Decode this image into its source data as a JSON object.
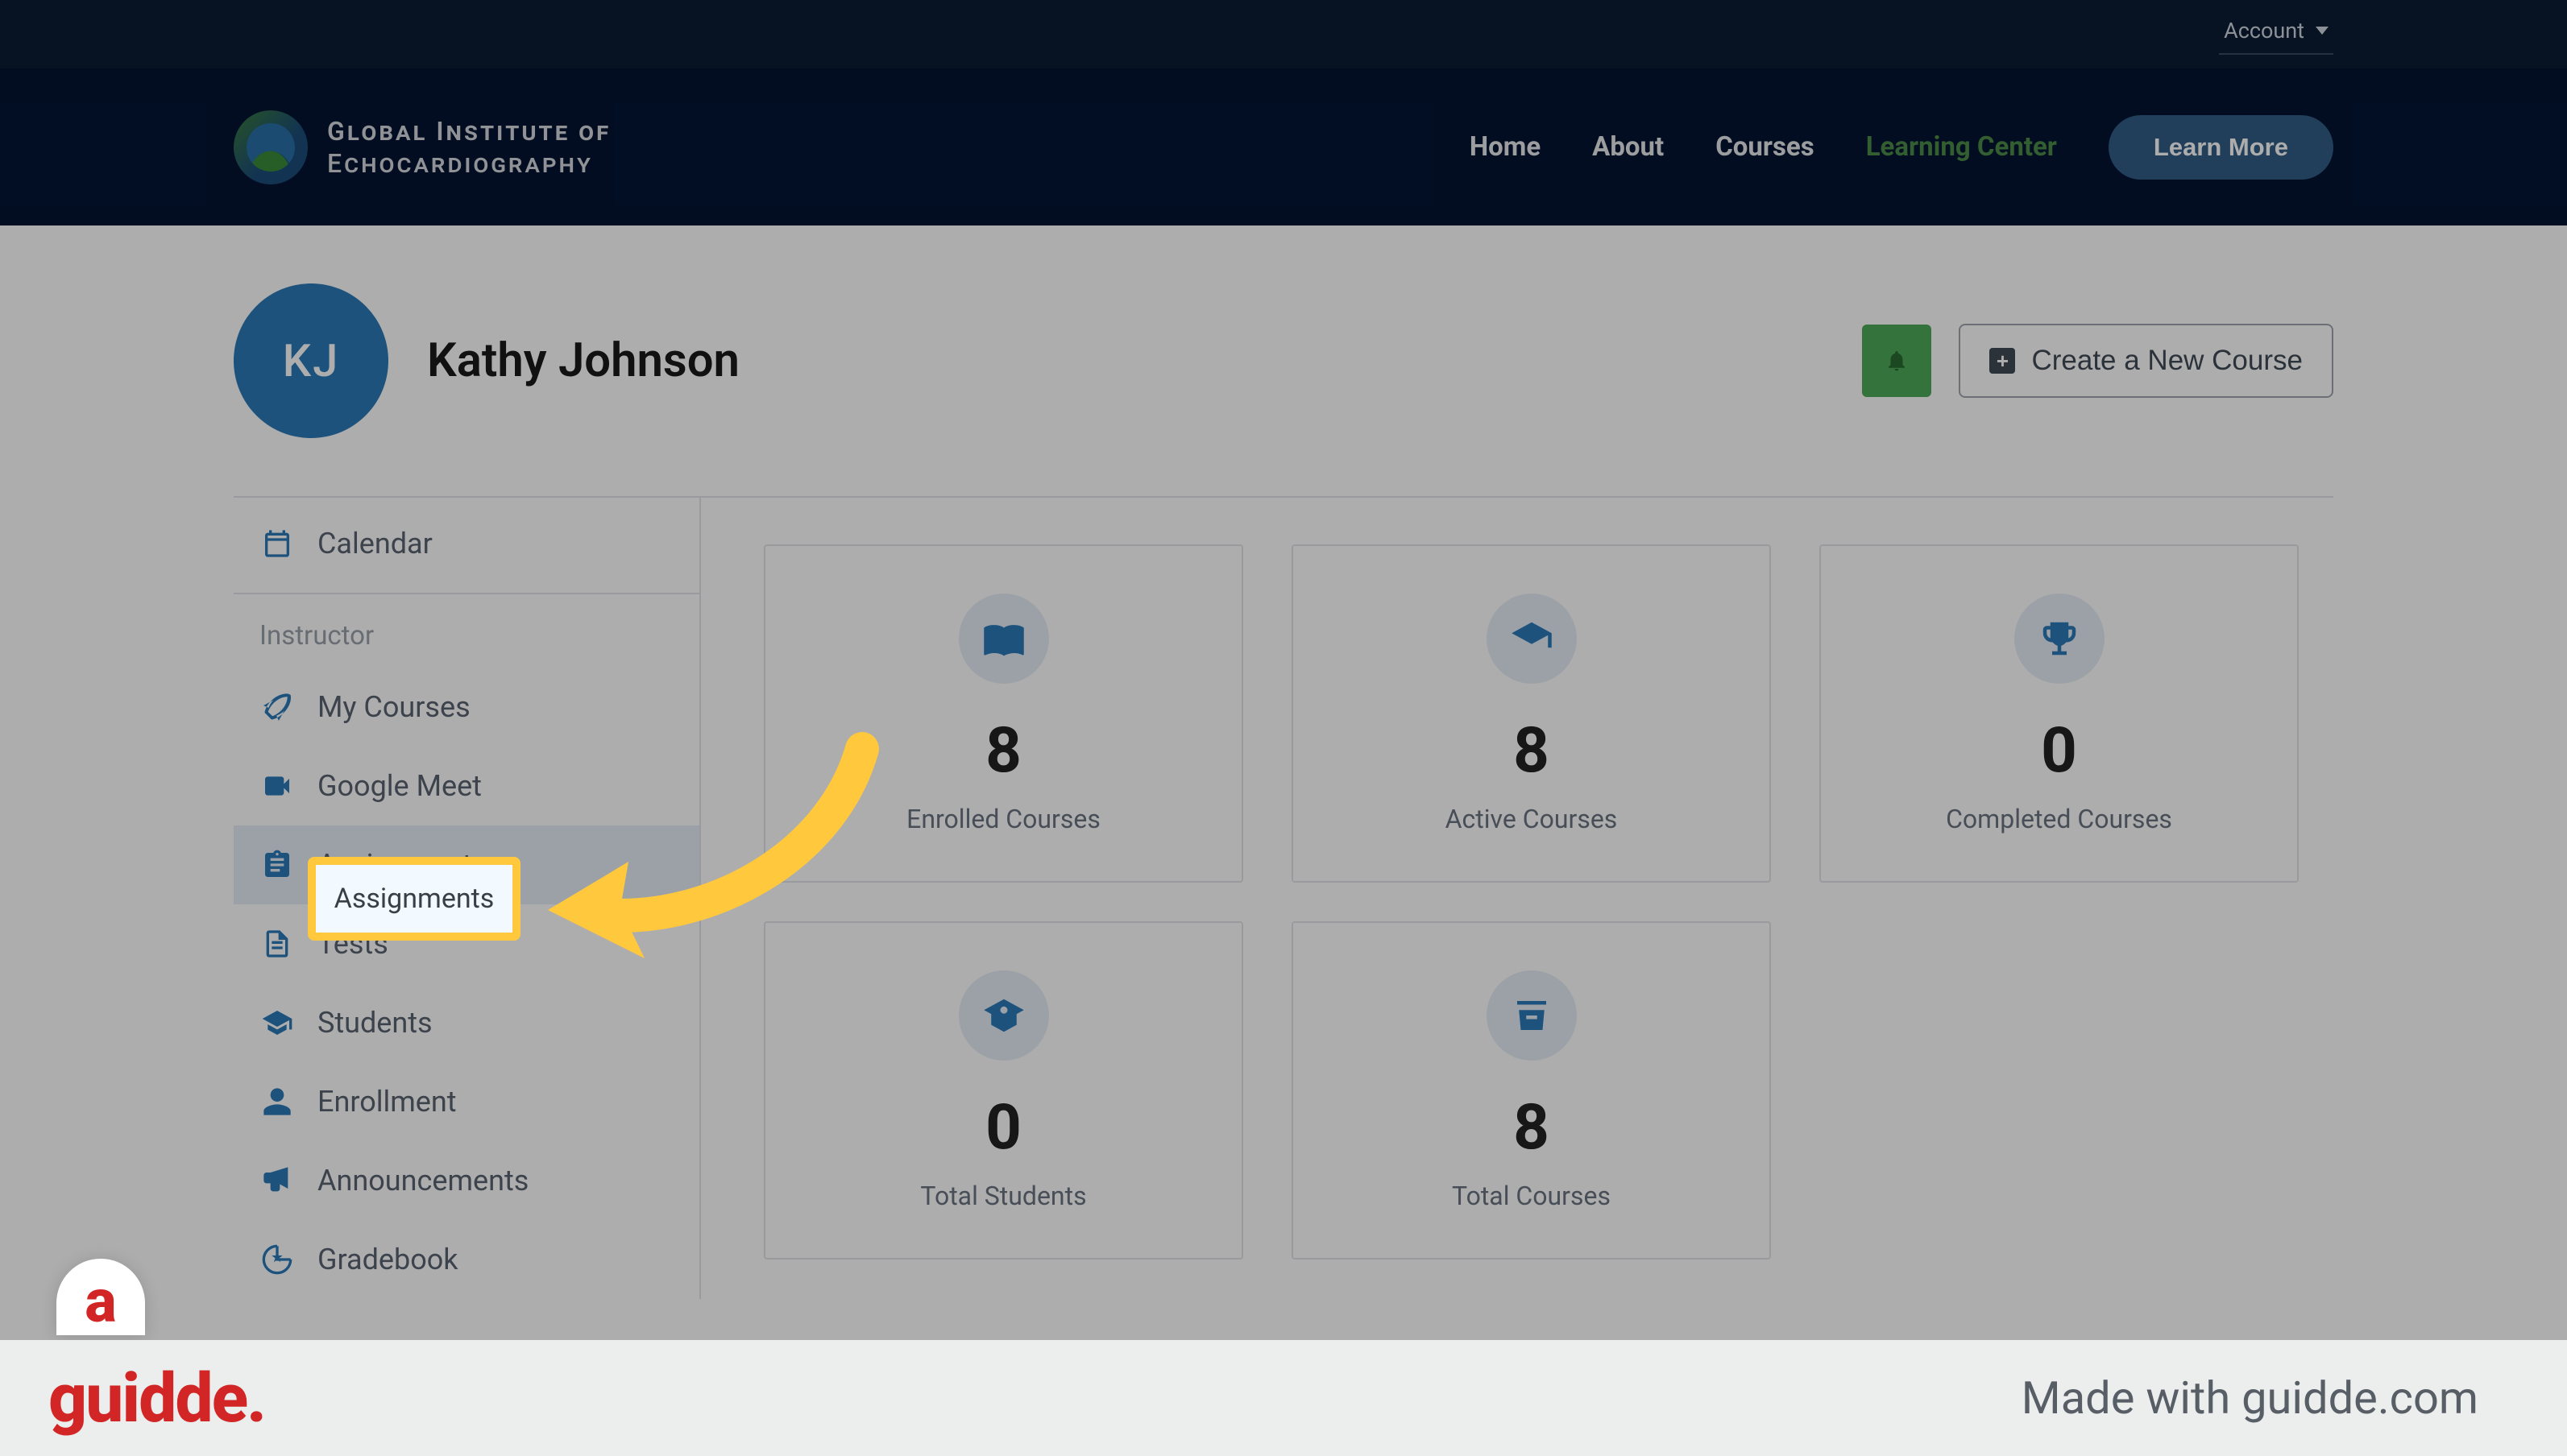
{
  "topbar": {
    "account_label": "Account"
  },
  "header": {
    "brand_line1": "Global Institute of",
    "brand_line2": "Echocardiography",
    "nav": {
      "home": "Home",
      "about": "About",
      "courses": "Courses",
      "learning_center": "Learning Center"
    },
    "learn_more": "Learn More"
  },
  "profile": {
    "initials": "KJ",
    "name": "Kathy Johnson",
    "create_course": "Create a New Course"
  },
  "sidebar": {
    "calendar": "Calendar",
    "section_label": "Instructor",
    "items": {
      "my_courses": "My Courses",
      "google_meet": "Google Meet",
      "assignments": "Assignments",
      "tests": "Tests",
      "students": "Students",
      "enrollment": "Enrollment",
      "announcements": "Announcements",
      "gradebook": "Gradebook"
    }
  },
  "dashboard": {
    "cards": [
      {
        "value": "8",
        "label": "Enrolled Courses"
      },
      {
        "value": "8",
        "label": "Active Courses"
      },
      {
        "value": "0",
        "label": "Completed Courses"
      },
      {
        "value": "0",
        "label": "Total Students"
      },
      {
        "value": "8",
        "label": "Total Courses"
      }
    ]
  },
  "highlight": {
    "label": "Assignments"
  },
  "footer": {
    "brand": "guidde.",
    "made_with": "Made with guidde.com",
    "round_g": "a"
  }
}
